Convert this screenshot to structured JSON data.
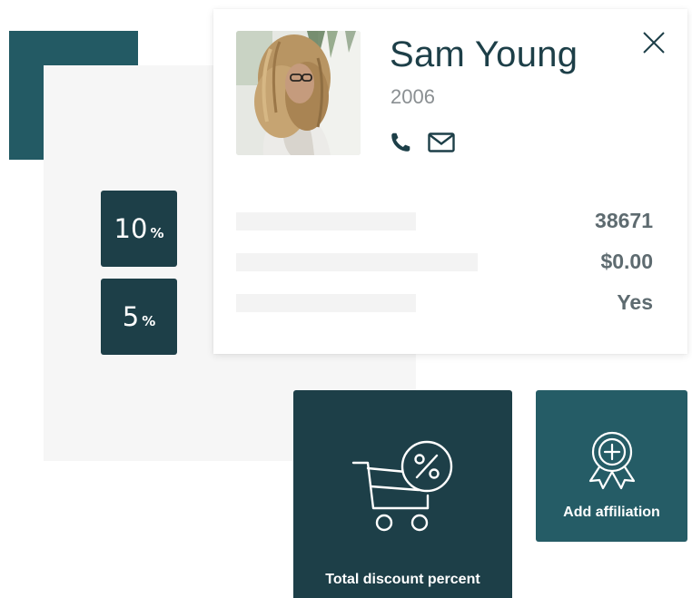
{
  "profile": {
    "name": "Sam Young",
    "year": "2006",
    "stats": [
      {
        "value": "38671"
      },
      {
        "value": "$0.00"
      },
      {
        "value": "Yes"
      }
    ]
  },
  "discounts": [
    {
      "value": "10",
      "unit": "%"
    },
    {
      "value": "5",
      "unit": "%"
    }
  ],
  "actions": {
    "discount_label": "Total discount percent",
    "affiliation_label": "Add affiliation"
  },
  "icons": {
    "phone": "phone-icon",
    "mail": "mail-icon",
    "close": "close-icon",
    "cart": "cart-percent-icon",
    "award": "award-badge-plus-icon"
  },
  "colors": {
    "dark_teal": "#1d3f48",
    "teal": "#255c66",
    "panel_gray": "#f6f6f6",
    "value_gray": "#5e6b70",
    "year_gray": "#8a8f92"
  }
}
